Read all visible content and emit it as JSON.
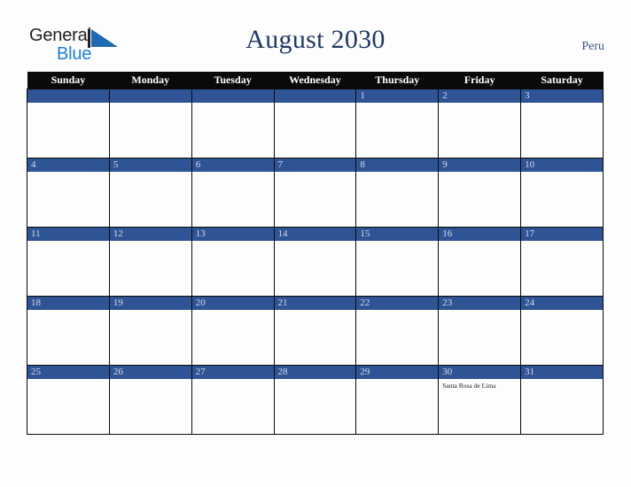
{
  "brand": {
    "name_part1": "General",
    "name_part2": "Blue",
    "triangle_icon": "blue-triangle-icon",
    "accent_color": "#1b7fd4",
    "dark_color": "#231f20"
  },
  "header": {
    "title": "August 2030",
    "country": "Peru",
    "title_color": "#1f3864",
    "country_color": "#3b5487"
  },
  "calendar": {
    "month": "August",
    "year": "2030",
    "weekday_headers": [
      "Sunday",
      "Monday",
      "Tuesday",
      "Wednesday",
      "Thursday",
      "Friday",
      "Saturday"
    ],
    "header_bg": "#0a0a0a",
    "daybar_bg": "#2f5496",
    "daybar_text_color": "#d8dce6",
    "cell_bg": "#fdfdfd",
    "border_color": "#0a0a0a",
    "weeks": [
      [
        {
          "date": "",
          "events": []
        },
        {
          "date": "",
          "events": []
        },
        {
          "date": "",
          "events": []
        },
        {
          "date": "",
          "events": []
        },
        {
          "date": "1",
          "events": []
        },
        {
          "date": "2",
          "events": []
        },
        {
          "date": "3",
          "events": []
        }
      ],
      [
        {
          "date": "4",
          "events": []
        },
        {
          "date": "5",
          "events": []
        },
        {
          "date": "6",
          "events": []
        },
        {
          "date": "7",
          "events": []
        },
        {
          "date": "8",
          "events": []
        },
        {
          "date": "9",
          "events": []
        },
        {
          "date": "10",
          "events": []
        }
      ],
      [
        {
          "date": "11",
          "events": []
        },
        {
          "date": "12",
          "events": []
        },
        {
          "date": "13",
          "events": []
        },
        {
          "date": "14",
          "events": []
        },
        {
          "date": "15",
          "events": []
        },
        {
          "date": "16",
          "events": []
        },
        {
          "date": "17",
          "events": []
        }
      ],
      [
        {
          "date": "18",
          "events": []
        },
        {
          "date": "19",
          "events": []
        },
        {
          "date": "20",
          "events": []
        },
        {
          "date": "21",
          "events": []
        },
        {
          "date": "22",
          "events": []
        },
        {
          "date": "23",
          "events": []
        },
        {
          "date": "24",
          "events": []
        }
      ],
      [
        {
          "date": "25",
          "events": []
        },
        {
          "date": "26",
          "events": []
        },
        {
          "date": "27",
          "events": []
        },
        {
          "date": "28",
          "events": []
        },
        {
          "date": "29",
          "events": []
        },
        {
          "date": "30",
          "events": [
            "Santa Rosa de Lima"
          ]
        },
        {
          "date": "31",
          "events": []
        }
      ]
    ]
  }
}
